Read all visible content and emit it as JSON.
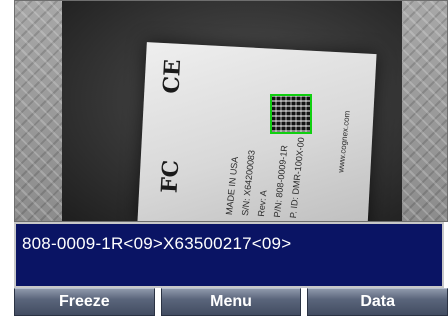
{
  "viewfinder": {
    "label_lines": [
      "P. ID: DMR-100X-00",
      "P/N: 808-0009-1R",
      "Rev: A",
      "S/N: X64200083",
      "MADE IN USA"
    ],
    "brand_text": "www.cognex.com",
    "marks": [
      "CE",
      "FC"
    ]
  },
  "result": {
    "text": "808-0009-1R<09>X63500217<09>"
  },
  "buttons": {
    "freeze": "Freeze",
    "menu": "Menu",
    "data": "Data"
  },
  "colors": {
    "result_background": "#0a1464",
    "decode_box": "#10d010"
  }
}
